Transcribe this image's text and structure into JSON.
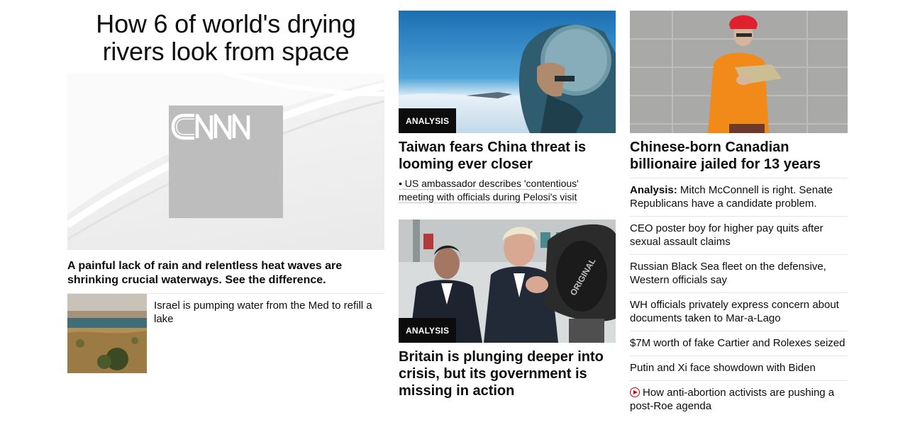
{
  "hero": {
    "title": "How 6 of world's drying rivers look from space",
    "caption": "A painful lack of rain and relentless heat waves are shrinking crucial waterways. See the difference.",
    "sub_story": "Israel is pumping water from the Med to refill a lake"
  },
  "middle": {
    "story1": {
      "badge": "ANALYSIS",
      "headline": "Taiwan fears China threat is looming ever closer",
      "related": "• US ambassador describes 'contentious' meeting with officials during Pelosi's visit"
    },
    "story2": {
      "badge": "ANALYSIS",
      "headline": "Britain is plunging deeper into crisis, but its government is missing in action"
    }
  },
  "right": {
    "headline": "Chinese-born Canadian billionaire jailed for 13 years",
    "list": [
      {
        "prefix": "Analysis:",
        "text": " Mitch McConnell is right. Senate Republicans have a candidate problem."
      },
      {
        "prefix": "",
        "text": "CEO poster boy for higher pay quits after sexual assault claims"
      },
      {
        "prefix": "",
        "text": "Russian Black Sea fleet on the defensive, Western officials say"
      },
      {
        "prefix": "",
        "text": "WH officials privately express concern about documents taken to Mar-a-Lago"
      },
      {
        "prefix": "",
        "text": "$7M worth of fake Cartier and Rolexes seized"
      },
      {
        "prefix": "",
        "text": "Putin and Xi face showdown with Biden"
      },
      {
        "prefix": "",
        "text": "How anti-abortion activists are pushing a post-Roe agenda"
      }
    ]
  },
  "logo_text": "CNN",
  "colors": {
    "badge_bg": "#0c0c0c",
    "video_icon": "#cc0000"
  }
}
